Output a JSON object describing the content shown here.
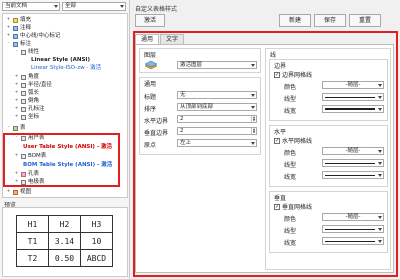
{
  "left": {
    "filter1": "当前文档",
    "filter2": "全部",
    "tree": [
      {
        "toggle": "+",
        "text": "填充",
        "icon": "yellow"
      },
      {
        "toggle": "+",
        "text": "注释",
        "icon": "blue"
      },
      {
        "toggle": "+",
        "text": "中心线/中心标记",
        "icon": "blue"
      },
      {
        "toggle": "-",
        "text": "标注",
        "icon": "blue"
      },
      {
        "toggle": "-",
        "text": "线性",
        "icon": "gray"
      },
      {
        "toggle": "",
        "text": "Linear Style (ANSI)",
        "icon": "none"
      },
      {
        "toggle": "",
        "text": "Linear Style-ISO-zw - 激活",
        "icon": "none"
      },
      {
        "toggle": "+",
        "text": "角度",
        "icon": "gray"
      },
      {
        "toggle": "+",
        "text": "半径/直径",
        "icon": "gray"
      },
      {
        "toggle": "+",
        "text": "弧长",
        "icon": "gray"
      },
      {
        "toggle": "+",
        "text": "倒角",
        "icon": "gray"
      },
      {
        "toggle": "+",
        "text": "孔标注",
        "icon": "gray"
      },
      {
        "toggle": "+",
        "text": "坐标",
        "icon": "gray"
      },
      {
        "toggle": "-",
        "text": "表",
        "icon": "green"
      },
      {
        "toggle": "-",
        "text": "用户表",
        "icon": "gray"
      },
      {
        "toggle": "",
        "text": "User Table Style (ANSI) - 激活",
        "icon": "none"
      },
      {
        "toggle": "+",
        "text": "BOM表",
        "icon": "gray"
      },
      {
        "toggle": "",
        "text": "BOM Table Style (ANSI) - 激活",
        "icon": "none"
      },
      {
        "toggle": "+",
        "text": "孔表",
        "icon": "gray"
      },
      {
        "toggle": "+",
        "text": "电极表",
        "icon": "gray"
      },
      {
        "toggle": "+",
        "text": "视图",
        "icon": "orange"
      }
    ],
    "preview_label": "预览",
    "preview_table": [
      [
        "H1",
        "H2",
        "H3"
      ],
      [
        "T1",
        "3.14",
        "10"
      ],
      [
        "T2",
        "0.50",
        "ABCD"
      ]
    ]
  },
  "right": {
    "title": "自定义表格样式",
    "buttons": {
      "activate": "激活",
      "new": "新建",
      "save": "保存",
      "reset": "重置"
    },
    "tabs": [
      "通用",
      "文字"
    ],
    "layer": {
      "title": "图层",
      "value": "激活图层"
    },
    "general": {
      "title": "通用",
      "rows": [
        {
          "label": "标题",
          "value": "无"
        },
        {
          "label": "排序",
          "value": "从顶部到底部"
        },
        {
          "label": "水平边界",
          "value": "2"
        },
        {
          "label": "垂直边界",
          "value": "2"
        },
        {
          "label": "原点",
          "value": "左上"
        }
      ]
    },
    "line": {
      "title": "线",
      "sections": [
        {
          "title": "边界",
          "check": "边界网格线",
          "color_label": "颜色",
          "color_value": "-随层-",
          "type_label": "线型",
          "width_label": "线宽"
        },
        {
          "title": "水平",
          "check": "水平网格线",
          "color_label": "颜色",
          "color_value": "-随层-",
          "type_label": "线型",
          "width_label": "线宽"
        },
        {
          "title": "垂直",
          "check": "垂直网格线",
          "color_label": "颜色",
          "color_value": "-随层-",
          "type_label": "线型",
          "width_label": "线宽"
        }
      ]
    }
  }
}
